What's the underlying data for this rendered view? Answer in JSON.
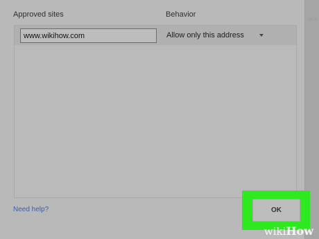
{
  "backdrop": {
    "ghost_text": "ock"
  },
  "dialog": {
    "header_sites": "Approved sites",
    "header_behavior": "Behavior",
    "site_value": "www.wikihow.com",
    "behavior_selected": "Allow only this address",
    "help_link": "Need help?",
    "ok_label": "OK"
  },
  "watermark": {
    "wiki": "wiki",
    "how": "How"
  },
  "colors": {
    "highlight": "#2ee820",
    "link": "#3b5ea4",
    "input_border": "#4a6fb5"
  },
  "icons": {
    "behavior_dropdown": "chevron-down-icon"
  }
}
